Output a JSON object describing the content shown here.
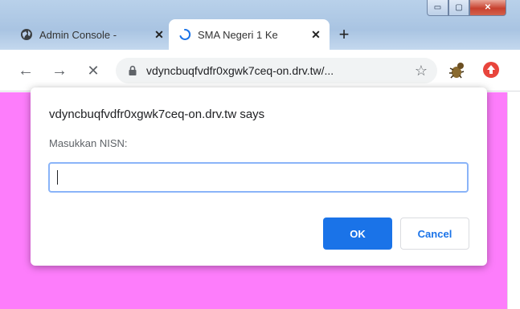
{
  "tabs": [
    {
      "title": "Admin Console - ",
      "favicon": "globe-icon",
      "close": "✕",
      "active": false
    },
    {
      "title": "SMA Negeri 1 Ke",
      "favicon": "loading-spinner-icon",
      "close": "✕",
      "active": true
    }
  ],
  "new_tab": "+",
  "window_controls": {
    "minimize": "▭",
    "maximize": "▢",
    "close": "✕"
  },
  "toolbar": {
    "back": "←",
    "forward": "→",
    "stop": "✕",
    "url": "vdyncbuqfvdfr0xgwk7ceq-on.drv.tw/...",
    "bookmark": "☆"
  },
  "dialog": {
    "title": "vdyncbuqfvdfr0xgwk7ceq-on.drv.tw says",
    "message": "Masukkan NISN:",
    "input_value": "",
    "ok_label": "OK",
    "cancel_label": "Cancel"
  },
  "colors": {
    "page_background": "#fd7dfb",
    "primary_button": "#1a73e8",
    "extension_red": "#e8453c"
  }
}
